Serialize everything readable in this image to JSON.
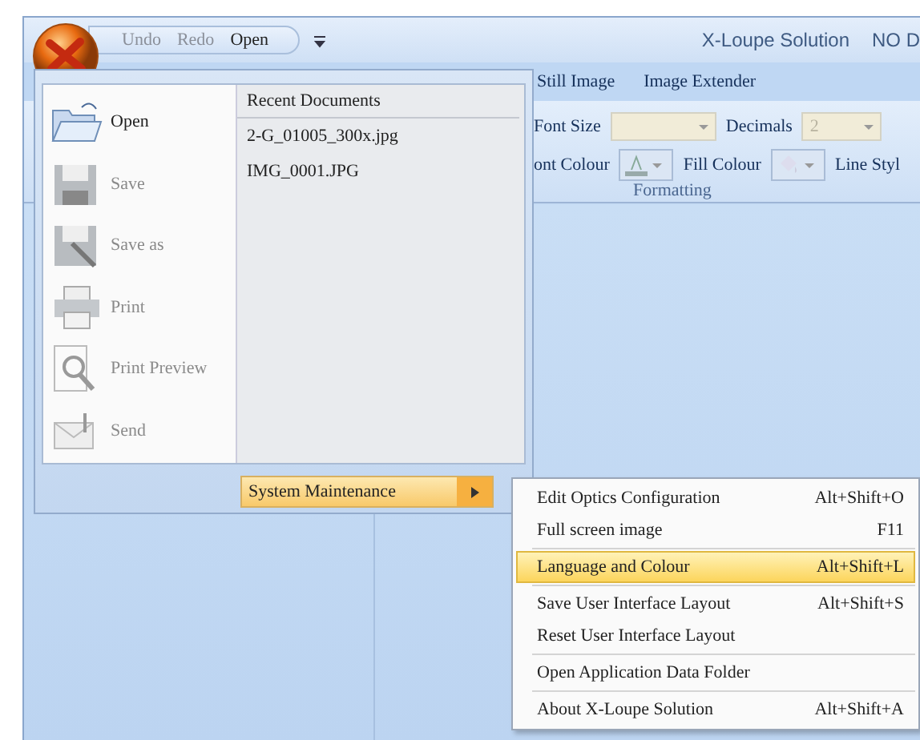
{
  "window": {
    "title": "X-Loupe Solution",
    "title_suffix": "NO D"
  },
  "quick_access": [
    {
      "label": "Undo",
      "disabled": true
    },
    {
      "label": "Redo",
      "disabled": true
    },
    {
      "label": "Open",
      "disabled": false
    }
  ],
  "ribbon": {
    "tabs": [
      "Still Image",
      "Image Extender"
    ],
    "group": {
      "label": "Formatting",
      "rows": [
        [
          {
            "kind": "dropdown",
            "label": "Font Size"
          },
          {
            "kind": "dropdown",
            "label": "Decimals",
            "value": "2"
          }
        ],
        [
          {
            "kind": "color",
            "label": "ont Colour"
          },
          {
            "kind": "color",
            "label": "Fill Colour"
          },
          {
            "kind": "text",
            "label": "Line Styl"
          }
        ]
      ]
    }
  },
  "app_menu": {
    "commands": [
      {
        "kind": "open",
        "label": "Open",
        "disabled": false
      },
      {
        "kind": "save",
        "label": "Save",
        "disabled": true
      },
      {
        "kind": "saveas",
        "label": "Save as",
        "disabled": true
      },
      {
        "kind": "print",
        "label": "Print",
        "disabled": true
      },
      {
        "kind": "preview",
        "label": "Print Preview",
        "disabled": true
      },
      {
        "kind": "send",
        "label": "Send",
        "disabled": true
      }
    ],
    "recent_title": "Recent Documents",
    "recent": [
      "2-G_01005_300x.jpg",
      "IMG_0001.JPG"
    ],
    "maintenance": {
      "label": "System Maintenance",
      "selected": true
    }
  },
  "submenu": [
    {
      "label": "Edit Optics Configuration",
      "shortcut": "Alt+Shift+O",
      "selected": false,
      "group_start": false
    },
    {
      "label": "Full screen image",
      "shortcut": "F11",
      "selected": false,
      "group_start": false
    },
    {
      "label": "Language and Colour",
      "shortcut": "Alt+Shift+L",
      "selected": true,
      "group_start": true
    },
    {
      "label": "Save User Interface Layout",
      "shortcut": "Alt+Shift+S",
      "selected": false,
      "group_start": true
    },
    {
      "label": "Reset User Interface Layout",
      "selected": false,
      "group_start": false
    },
    {
      "label": "Open Application Data Folder",
      "selected": false,
      "group_start": true
    },
    {
      "label": "About X-Loupe Solution",
      "shortcut": "Alt+Shift+A",
      "selected": false,
      "group_start": true
    }
  ]
}
